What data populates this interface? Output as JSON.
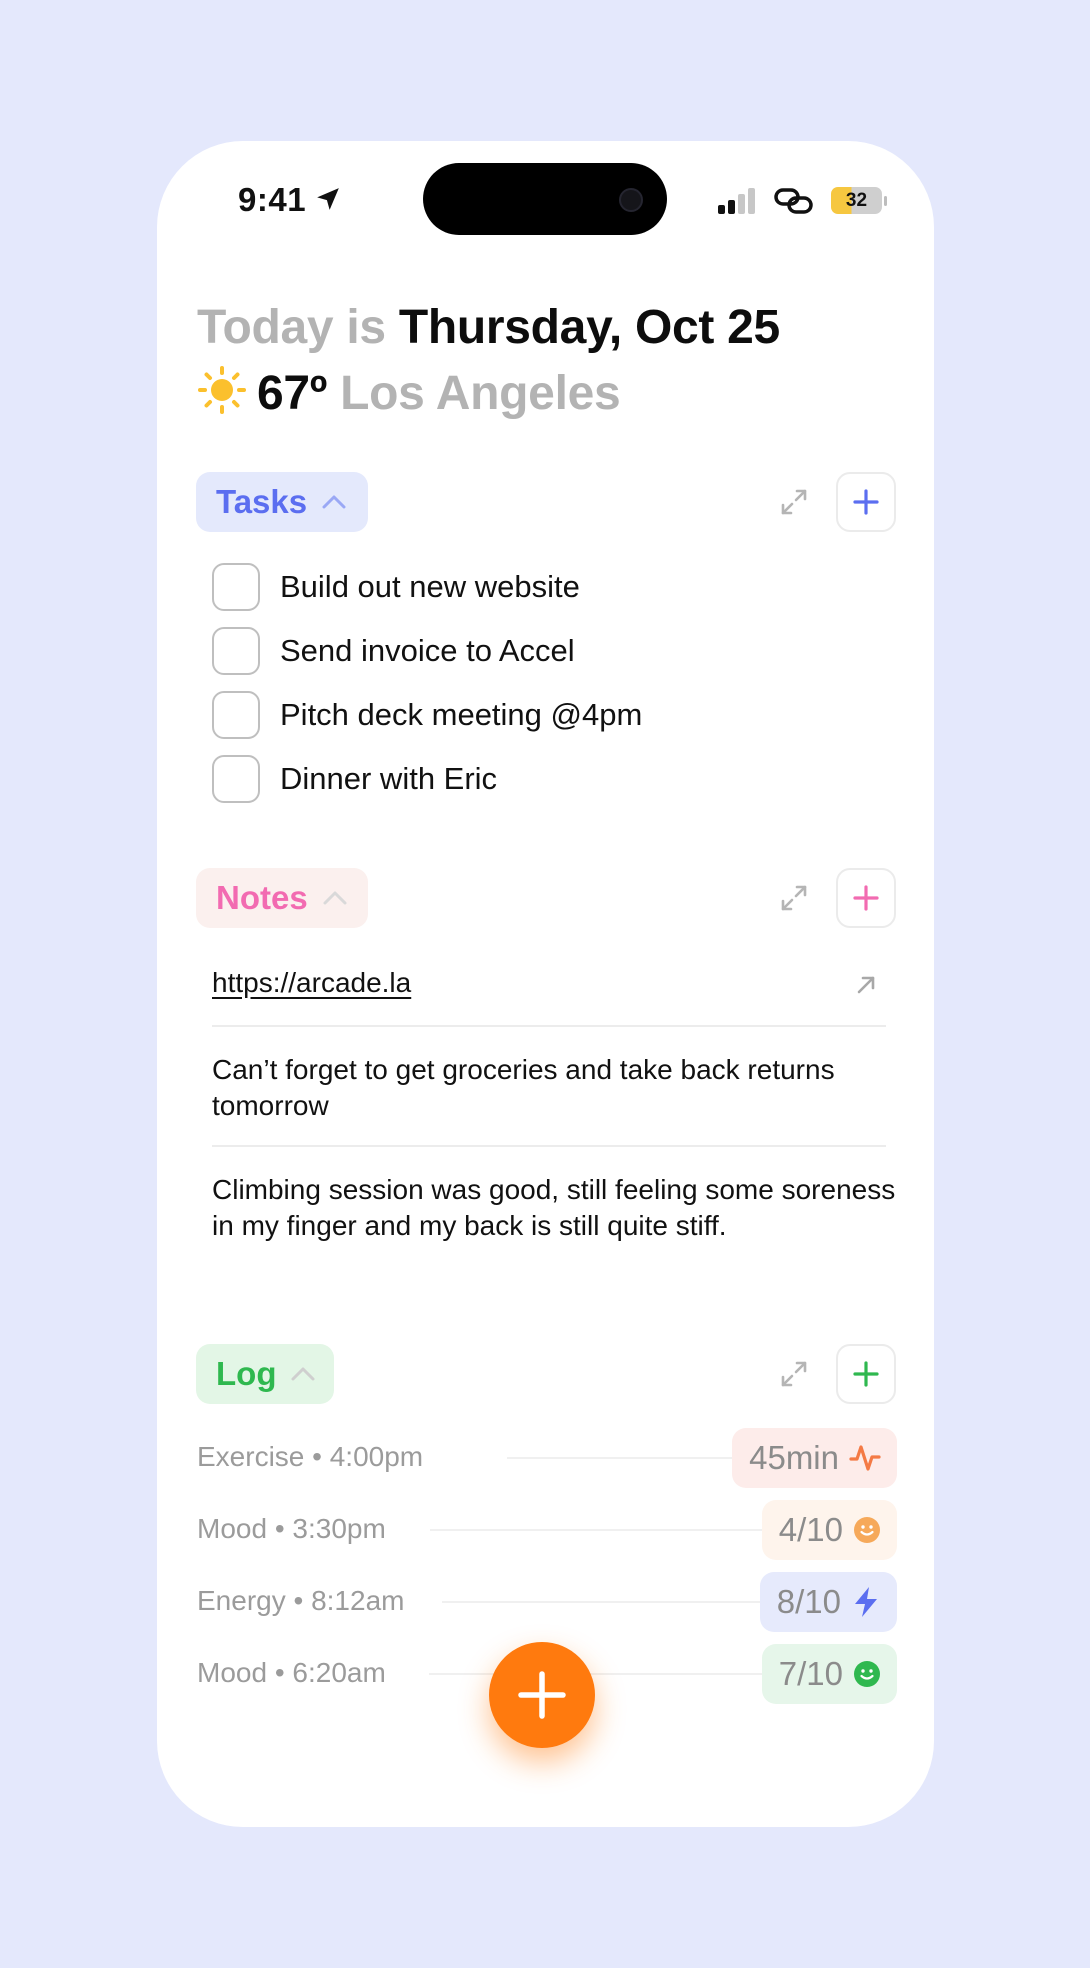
{
  "status_bar": {
    "time": "9:41",
    "battery": "32",
    "icons": [
      "location-arrow-icon",
      "signal-icon",
      "link-icon",
      "battery-icon"
    ]
  },
  "header": {
    "today_prefix": "Today is",
    "date": "Thursday, Oct 25",
    "weather_icon": "sun-icon",
    "temperature": "67º",
    "city": "Los Angeles"
  },
  "tasks": {
    "title": "Tasks",
    "accent": "#5b6ef0",
    "pill_bg": "#e4e9fc",
    "items": [
      {
        "label": "Build out new website",
        "checked": false
      },
      {
        "label": "Send invoice to Accel",
        "checked": false
      },
      {
        "label": "Pitch deck meeting @4pm",
        "checked": false
      },
      {
        "label": "Dinner with Eric",
        "checked": false
      }
    ]
  },
  "notes": {
    "title": "Notes",
    "accent": "#f26bb1",
    "pill_bg": "#fbf0ee",
    "items": [
      {
        "text": "https://arcade.la",
        "is_link": true
      },
      {
        "text": "Can’t forget to get groceries and take back returns tomorrow",
        "is_link": false
      },
      {
        "text": "Climbing session was good, still feeling some soreness in my finger and my back is still quite stiff.",
        "is_link": false
      }
    ]
  },
  "log": {
    "title": "Log",
    "accent": "#2fb84f",
    "pill_bg": "#e3f6e6",
    "items": [
      {
        "label": "Exercise • 4:00pm",
        "value": "45min",
        "icon": "activity-icon",
        "color": "#f47a45",
        "bg": "#fdecea"
      },
      {
        "label": "Mood • 3:30pm",
        "value": "4/10",
        "icon": "smiley-icon",
        "color": "#f6a95a",
        "bg": "#fef4ec"
      },
      {
        "label": "Energy • 8:12am",
        "value": "8/10",
        "icon": "lightning-icon",
        "color": "#5b6ef0",
        "bg": "#e6eafc"
      },
      {
        "label": "Mood • 6:20am",
        "value": "7/10",
        "icon": "smiley-icon",
        "color": "#2fb84f",
        "bg": "#e6f6ea"
      }
    ]
  },
  "fab": {
    "icon": "plus-icon",
    "color": "#ff7a0e"
  }
}
